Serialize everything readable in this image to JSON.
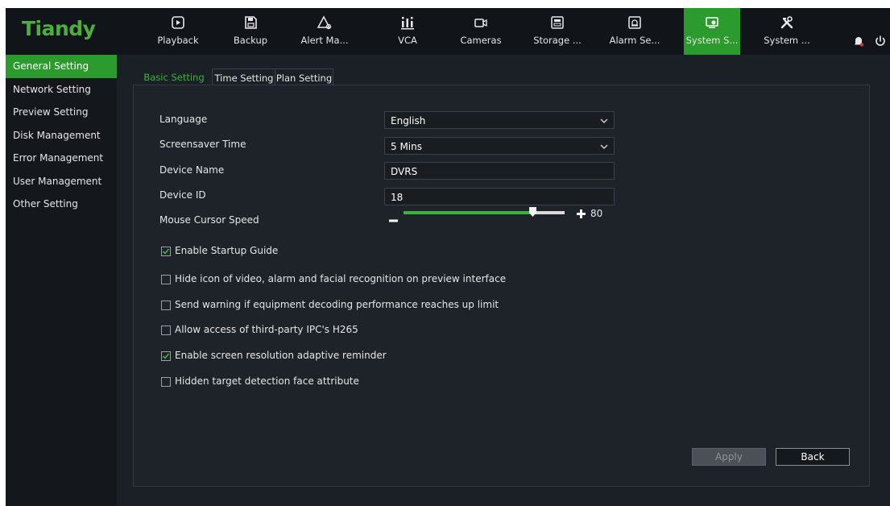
{
  "app": {
    "logo": "Tiandy"
  },
  "nav": {
    "items": [
      {
        "label": "Playback",
        "icon": "playback-icon"
      },
      {
        "label": "Backup",
        "icon": "save-icon"
      },
      {
        "label": "Alert Ma...",
        "icon": "alert-icon"
      },
      {
        "label": "VCA",
        "icon": "vca-icon"
      },
      {
        "label": "Cameras",
        "icon": "camera-icon"
      },
      {
        "label": "Storage ...",
        "icon": "storage-icon"
      },
      {
        "label": "Alarm Se...",
        "icon": "alarm-icon"
      },
      {
        "label": "System S...",
        "icon": "system-settings-icon",
        "active": true
      },
      {
        "label": "System ...",
        "icon": "tools-icon"
      }
    ],
    "accent": "#2c9b2d",
    "logo_color": "#4cae3c",
    "notification_dot": "#d23a2f"
  },
  "sidebar": {
    "items": [
      {
        "label": "General Setting",
        "active": true
      },
      {
        "label": "Network Setting"
      },
      {
        "label": "Preview Setting"
      },
      {
        "label": "Disk Management"
      },
      {
        "label": "Error Management"
      },
      {
        "label": "User Management"
      },
      {
        "label": "Other Setting"
      }
    ]
  },
  "tabs": [
    {
      "label": "Basic Setting",
      "active": true
    },
    {
      "label": "Time Setting"
    },
    {
      "label": "Plan Setting"
    }
  ],
  "form": {
    "language": {
      "label": "Language",
      "value": "English"
    },
    "screensaver": {
      "label": "Screensaver Time",
      "value": "5 Mins"
    },
    "device_name": {
      "label": "Device Name",
      "value": "DVRS"
    },
    "device_id": {
      "label": "Device ID",
      "value": "18"
    },
    "mouse_speed": {
      "label": "Mouse Cursor Speed",
      "value": "80",
      "fraction": 0.8
    }
  },
  "checkboxes": [
    {
      "label": "Enable Startup Guide",
      "checked": true
    },
    {
      "label": "Hide icon of video, alarm and facial recognition on preview interface",
      "checked": false
    },
    {
      "label": "Send warning if equipment decoding performance reaches up limit",
      "checked": false
    },
    {
      "label": "Allow access of third-party IPC's H265",
      "checked": false
    },
    {
      "label": "Enable screen resolution adaptive reminder",
      "checked": true
    },
    {
      "label": "Hidden target detection face attribute",
      "checked": false
    }
  ],
  "buttons": {
    "apply": "Apply",
    "back": "Back"
  }
}
